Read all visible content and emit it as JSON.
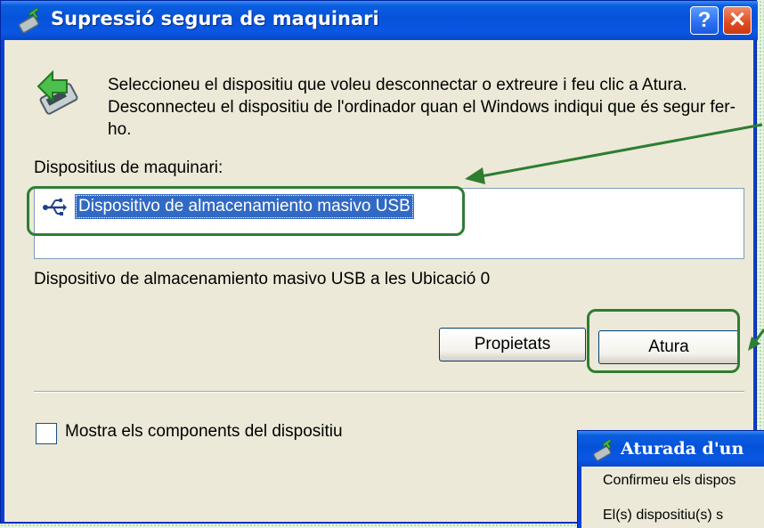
{
  "dialog": {
    "title": "Supressió segura de maquinari",
    "help_button": "?",
    "close_button": "✕",
    "description": "Seleccioneu el dispositiu que voleu desconnectar o extreure i feu clic a Atura. Desconnecteu el dispositiu de l'ordinador quan el Windows indiqui que és segur fer-ho.",
    "list_label": "Dispositius de maquinari:",
    "devices": [
      {
        "label": "Dispositivo de almacenamiento masivo USB",
        "icon": "usb-icon",
        "selected": true
      }
    ],
    "status_text": "Dispositivo de almacenamiento masivo USB a les Ubicació 0",
    "properties_button": "Propietats",
    "stop_button": "Atura",
    "show_components_label": "Mostra els components del dispositiu",
    "show_components_checked": false
  },
  "second_window": {
    "title": "Aturada d'un",
    "line1": "Confirmeu els dispos",
    "line2": "El(s) dispositiu(s) s"
  },
  "colors": {
    "titlebar": "#0a5ee0",
    "selection": "#316ac5",
    "highlight": "#2e7d32",
    "dialog_bg": "#ece9d8"
  }
}
